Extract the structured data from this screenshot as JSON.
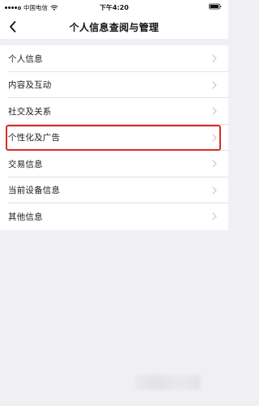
{
  "status_bar": {
    "carrier": "中国电信",
    "time": "下午4:20",
    "signal_bars_filled": 4,
    "signal_bars_total": 5
  },
  "nav": {
    "title": "个人信息查阅与管理",
    "back_icon": "chevron-left-icon"
  },
  "menu": {
    "items": [
      {
        "label": "个人信息"
      },
      {
        "label": "内容及互动"
      },
      {
        "label": "社交及关系"
      },
      {
        "label": "个性化及广告",
        "highlighted": true
      },
      {
        "label": "交易信息"
      },
      {
        "label": "当前设备信息"
      },
      {
        "label": "其他信息"
      }
    ],
    "item_icon": "chevron-right-icon"
  },
  "colors": {
    "page_background": "#efeff4",
    "surface": "#ffffff",
    "highlight_border": "#d82b26",
    "divider": "#e2e2e6",
    "chevron": "#c7c7cc"
  }
}
